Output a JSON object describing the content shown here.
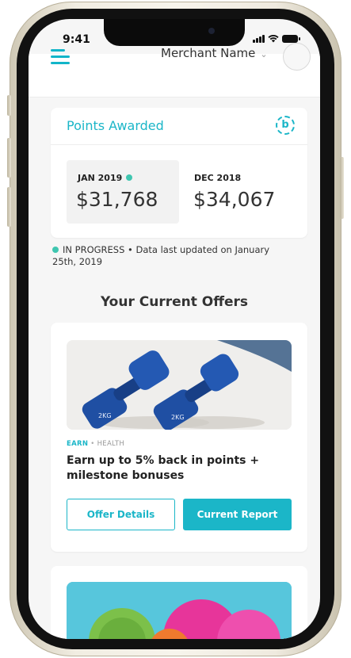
{
  "status_bar": {
    "time": "9:41"
  },
  "header": {
    "merchant_name": "Merchant Name",
    "chevron": "⌄"
  },
  "points": {
    "title": "Points Awarded",
    "badge_letter": "b",
    "current": {
      "label": "JAN 2019",
      "value": "$31,768"
    },
    "previous": {
      "label": "DEC 2018",
      "value": "$34,067"
    },
    "progress_text": "IN PROGRESS • Data last updated on January 25th, 2019"
  },
  "offers": {
    "heading": "Your Current Offers",
    "items": [
      {
        "tag": "EARN",
        "separator": " • ",
        "category": "HEALTH",
        "title": "Earn up to 5% back in points + milestone bonuses",
        "details_label": "Offer Details",
        "report_label": "Current Report",
        "image_text": "2KG"
      }
    ]
  },
  "colors": {
    "accent": "#1bb6c8",
    "status_dot": "#3fc6b0",
    "dumbbell": "#1f4fa3"
  }
}
